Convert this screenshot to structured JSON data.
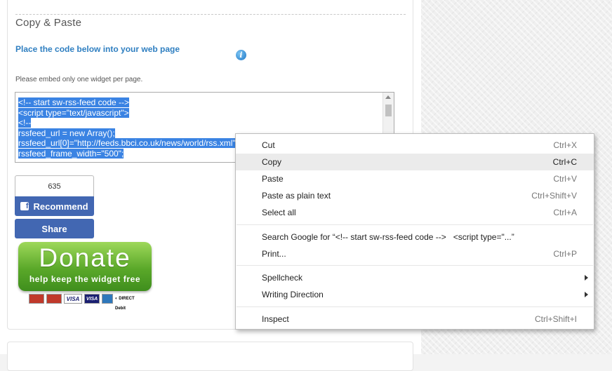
{
  "section": {
    "title": "Copy & Paste",
    "instruction": "Place the code below into your web page",
    "info_icon": "i",
    "note": "Please embed only one widget per page."
  },
  "code_box": {
    "lines": [
      "<!-- start sw-rss-feed code -->",
      "<script type=\"text/javascript\">",
      "<!--",
      "rssfeed_url = new Array();",
      "rssfeed_url[0]=\"http://feeds.bbci.co.uk/news/world/rss.xml\";",
      "rssfeed_frame_width=\"500\";"
    ]
  },
  "social": {
    "count": "635",
    "fb_glyph": "f",
    "recommend_label": "Recommend",
    "share_label": "Share"
  },
  "donate": {
    "main": "Donate",
    "sub": "help keep the widget free",
    "payment_marks": [
      "MasterCard",
      "Maestro",
      "VISA",
      "VISA",
      "AMEX",
      "DIRECT Debit"
    ]
  },
  "context_menu": {
    "items": [
      {
        "label": "Cut",
        "shortcut": "Ctrl+X"
      },
      {
        "label": "Copy",
        "shortcut": "Ctrl+C"
      },
      {
        "label": "Paste",
        "shortcut": "Ctrl+V"
      },
      {
        "label": "Paste as plain text",
        "shortcut": "Ctrl+Shift+V"
      },
      {
        "label": "Select all",
        "shortcut": "Ctrl+A"
      },
      {
        "label": "Search Google for “<!-- start sw-rss-feed code -->   <script type=\"...”",
        "shortcut": ""
      },
      {
        "label": "Print...",
        "shortcut": "Ctrl+P"
      },
      {
        "label": "Spellcheck",
        "shortcut": ""
      },
      {
        "label": "Writing Direction",
        "shortcut": ""
      },
      {
        "label": "Inspect",
        "shortcut": "Ctrl+Shift+I"
      }
    ]
  },
  "colors": {
    "selection": "#3a83e3",
    "facebook": "#4267b2",
    "donate_green": "#5aa829",
    "link_blue": "#2f7fc1"
  }
}
